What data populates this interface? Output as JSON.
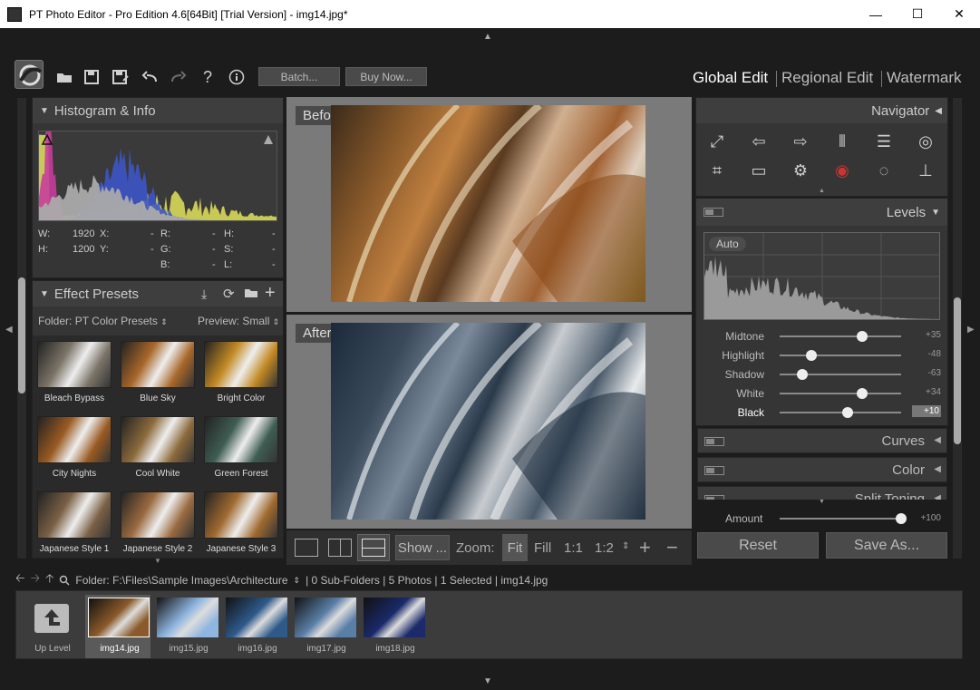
{
  "window": {
    "title": "PT Photo Editor - Pro Edition 4.6[64Bit] [Trial Version] - img14.jpg*"
  },
  "toolbar": {
    "icons": [
      "logo-icon",
      "open-folder-icon",
      "save-icon",
      "save-as-icon",
      "undo-icon",
      "redo-icon",
      "help-icon",
      "info-icon"
    ],
    "batch_label": "Batch...",
    "buy_label": "Buy Now..."
  },
  "modes": [
    "Global Edit",
    "Regional Edit",
    "Watermark"
  ],
  "histogram_panel": {
    "title": "Histogram & Info",
    "info": {
      "w_label": "W:",
      "w_value": "1920",
      "x_label": "X:",
      "x_value": "-",
      "r_label": "R:",
      "r_value": "-",
      "h2_label": "H:",
      "h2_value": "-",
      "h_label": "H:",
      "h_value": "1200",
      "y_label": "Y:",
      "y_value": "-",
      "g_label": "G:",
      "g_value": "-",
      "s_label": "S:",
      "s_value": "-",
      "b_label": "B:",
      "b_value": "-",
      "l_label": "L:",
      "l_value": "-"
    }
  },
  "presets_panel": {
    "title": "Effect Presets",
    "folder_label": "Folder:",
    "folder_value": "PT Color Presets",
    "preview_label": "Preview:",
    "preview_value": "Small",
    "items": [
      {
        "label": "Bleach Bypass",
        "color": "#7b7468"
      },
      {
        "label": "Blue Sky",
        "color": "#a8672a"
      },
      {
        "label": "Bright Color",
        "color": "#c28a24"
      },
      {
        "label": "City Nights",
        "color": "#9a5a22"
      },
      {
        "label": "Cool White",
        "color": "#8c6a3c"
      },
      {
        "label": "Green Forest",
        "color": "#3f5d52"
      },
      {
        "label": "Japanese Style 1",
        "color": "#7a6045"
      },
      {
        "label": "Japanese Style 2",
        "color": "#9a6a40"
      },
      {
        "label": "Japanese Style 3",
        "color": "#a06a30"
      }
    ]
  },
  "preview": {
    "before_label": "Before",
    "after_label": "After"
  },
  "view_bar": {
    "show_label": "Show ...",
    "zoom_label": "Zoom:",
    "fit": "Fit",
    "fill": "Fill",
    "one_to_one": "1:1",
    "one_to_two": "1:2",
    "plus": "+",
    "minus": "−"
  },
  "navigator": {
    "title": "Navigator",
    "tools": [
      "resize-icon",
      "rotate-left-icon",
      "rotate-right-icon",
      "flip-horizontal-icon",
      "flip-vertical-icon",
      "spiral-icon",
      "crop-icon",
      "straighten-icon",
      "lens-icon",
      "red-eye-icon",
      "vignette-icon",
      "stamp-icon"
    ]
  },
  "levels": {
    "title": "Levels",
    "auto_label": "Auto",
    "sliders": [
      {
        "label": "Midtone",
        "value": "+35",
        "pos": 0.68
      },
      {
        "label": "Highlight",
        "value": "-48",
        "pos": 0.26
      },
      {
        "label": "Shadow",
        "value": "-63",
        "pos": 0.19
      },
      {
        "label": "White",
        "value": "+34",
        "pos": 0.68
      },
      {
        "label": "Black",
        "value": "+10",
        "pos": 0.56
      }
    ]
  },
  "collapsed_panels": {
    "curves": "Curves",
    "color": "Color",
    "split": "Split Toning"
  },
  "amount": {
    "label": "Amount",
    "value": "+100"
  },
  "actions": {
    "reset": "Reset",
    "save_as": "Save As..."
  },
  "browser": {
    "path_text": "Folder:  F:\\Files\\Sample Images\\Architecture",
    "stats": "| 0 Sub-Folders | 5 Photos | 1 Selected | img14.jpg",
    "up_level": "Up Level",
    "files": [
      {
        "name": "img14.jpg",
        "color": "#8a5a2a"
      },
      {
        "name": "img15.jpg",
        "color": "#8fb6e0"
      },
      {
        "name": "img16.jpg",
        "color": "#2e5a8a"
      },
      {
        "name": "img17.jpg",
        "color": "#5a7fa6"
      },
      {
        "name": "img18.jpg",
        "color": "#1a2a6a"
      }
    ]
  }
}
